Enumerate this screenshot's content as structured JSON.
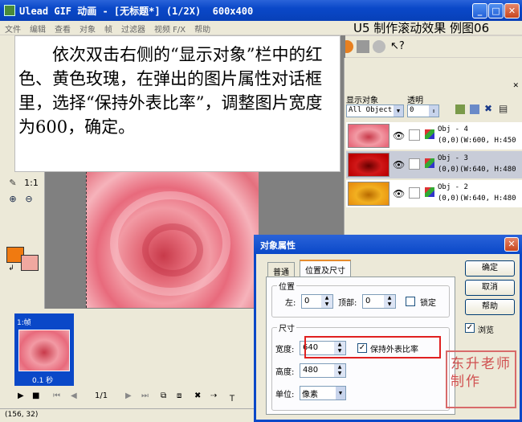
{
  "window": {
    "title": "Ulead GIF 动画 - [无标题*] (1/2X)  600x400"
  },
  "menu": [
    "文件",
    "编辑",
    "查看",
    "对象",
    "帧",
    "过滤器",
    "视频 F/X",
    "帮助"
  ],
  "lesson_title": "U5 制作滚动效果 例图06",
  "instruction": "依次双击右侧的“显示对象”栏中的红色、黄色玫瑰，在弹出的图片属性对话框里，选择“保持外表比率”，调整图片宽度为600，确定。",
  "left_tools": {
    "ratio_label": "1:1"
  },
  "object_panel": {
    "show_label": "显示对象",
    "opacity_label": "透明",
    "filter_value": "All Object:",
    "opacity_value": "0",
    "objects": [
      {
        "name": "Obj - 4",
        "info": "(0,0)(W:600, H:450",
        "color": "pink"
      },
      {
        "name": "Obj - 3",
        "info": "(0,0)(W:640, H:480",
        "color": "red"
      },
      {
        "name": "Obj - 2",
        "info": "(0,0)(W:640, H:480",
        "color": "yellow"
      }
    ]
  },
  "frames": {
    "frame_label": "1:帧",
    "frame_time": "0.1 秒",
    "counter": "1/1"
  },
  "status": {
    "coords": "(156, 32)"
  },
  "dialog": {
    "title": "对象属性",
    "tabs": [
      "普通",
      "位置及尺寸"
    ],
    "position_group": "位置",
    "left_label": "左:",
    "left_value": "0",
    "top_label": "顶部:",
    "top_value": "0",
    "lock_label": "锁定",
    "size_group": "尺寸",
    "width_label": "宽度:",
    "width_value": "640",
    "keep_ratio_label": "保持外表比率",
    "height_label": "高度:",
    "height_value": "480",
    "unit_label": "单位:",
    "unit_value": "像素",
    "ok_label": "确定",
    "cancel_label": "取消",
    "help_label": "帮助",
    "browse_label": "浏览"
  },
  "seal_text": "东升老师制作"
}
